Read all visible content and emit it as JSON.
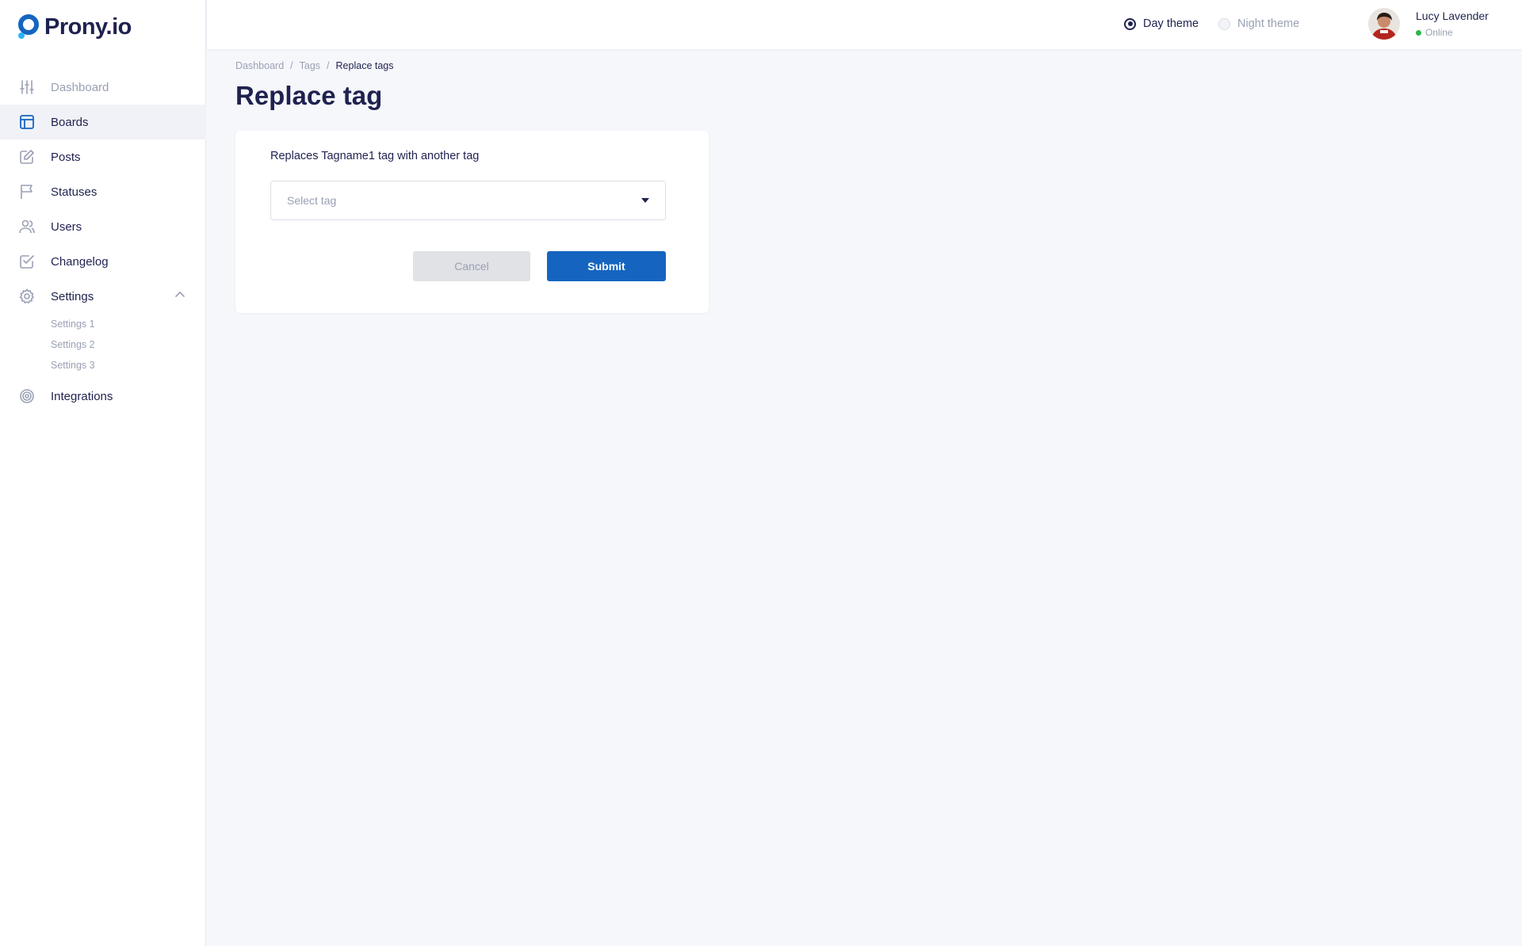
{
  "brand": {
    "name": "Prony.io",
    "color": "#1565c0"
  },
  "sidebar": {
    "items": [
      {
        "label": "Dashboard",
        "icon": "sliders-icon",
        "state": "dim"
      },
      {
        "label": "Boards",
        "icon": "board-icon",
        "state": "active"
      },
      {
        "label": "Posts",
        "icon": "edit-icon",
        "state": "normal"
      },
      {
        "label": "Statuses",
        "icon": "flag-icon",
        "state": "normal"
      },
      {
        "label": "Users",
        "icon": "users-icon",
        "state": "normal"
      },
      {
        "label": "Changelog",
        "icon": "check-square-icon",
        "state": "normal"
      },
      {
        "label": "Settings",
        "icon": "gear-icon",
        "state": "expanded"
      },
      {
        "label": "Integrations",
        "icon": "target-icon",
        "state": "normal"
      }
    ],
    "settings_sub": [
      "Settings 1",
      "Settings 2",
      "Settings 3"
    ]
  },
  "header": {
    "themes": [
      {
        "label": "Day theme",
        "selected": true
      },
      {
        "label": "Night theme",
        "selected": false
      }
    ],
    "user": {
      "name": "Lucy Lavender",
      "status": "Online",
      "status_color": "#2db54b"
    }
  },
  "breadcrumb": [
    "Dashboard",
    "Tags",
    "Replace tags"
  ],
  "page": {
    "title": "Replace tag"
  },
  "form": {
    "description": "Replaces Tagname1 tag with another tag",
    "select_placeholder": "Select tag",
    "cancel_label": "Cancel",
    "submit_label": "Submit"
  }
}
